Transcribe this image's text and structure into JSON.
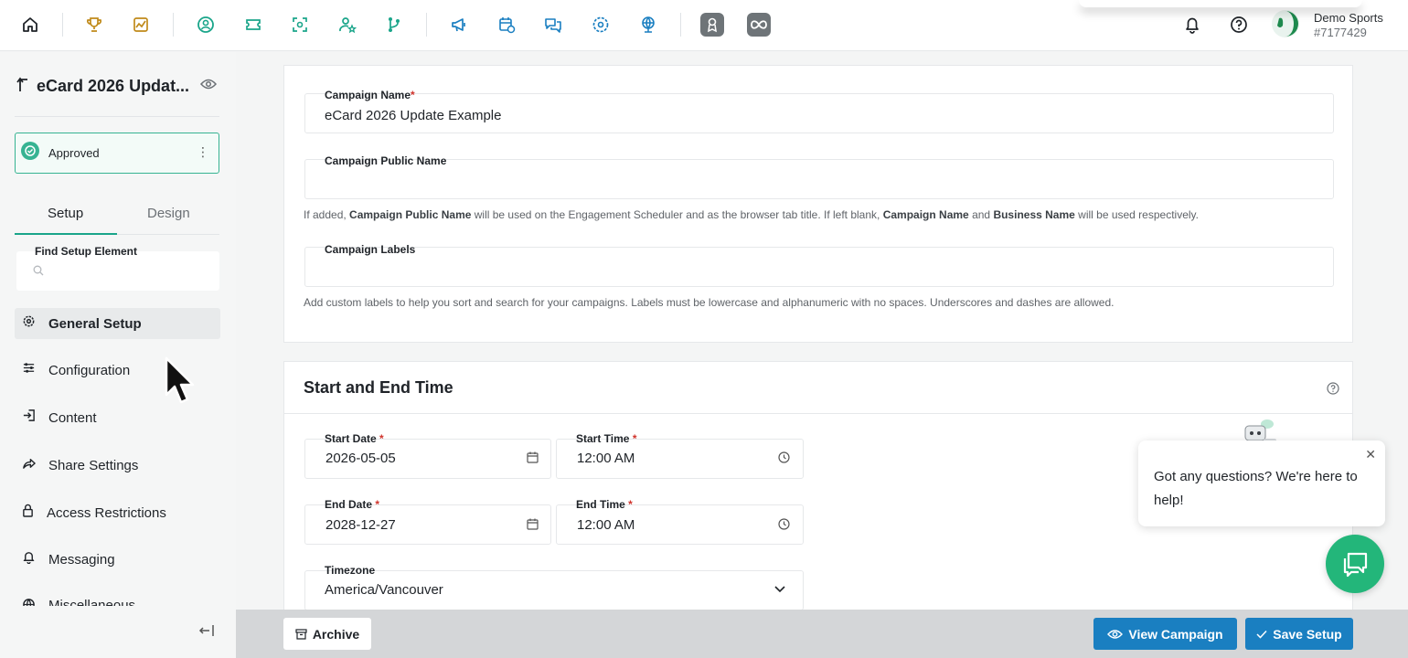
{
  "colors": {
    "accent": "#1aa58a",
    "primary_button": "#1a7fc1",
    "chat_green": "#23b67a",
    "required": "#d0342c"
  },
  "topbar": {
    "icons": [
      "home-icon",
      "trophy-icon",
      "analytics-icon",
      "user-circle-icon",
      "ticket-icon",
      "scan-icon",
      "user-star-icon",
      "branch-icon",
      "megaphone-icon",
      "calendar-clock-icon",
      "chat-icon",
      "gear-badge-icon",
      "globe-icon",
      "app-r-icon",
      "app-infinity-icon"
    ],
    "user": {
      "name": "Demo Sports",
      "id": "#7177429"
    }
  },
  "sidebar": {
    "title": "eCard 2026 Updat...",
    "status": "Approved",
    "tabs": [
      {
        "label": "Setup",
        "active": true
      },
      {
        "label": "Design",
        "active": false
      }
    ],
    "find_label": "Find Setup Element",
    "items": [
      {
        "label": "General Setup",
        "icon": "gear-icon",
        "active": true
      },
      {
        "label": "Configuration",
        "icon": "sliders-icon",
        "active": false
      },
      {
        "label": "Content",
        "icon": "enter-icon",
        "active": false
      },
      {
        "label": "Share Settings",
        "icon": "share-icon",
        "active": false
      },
      {
        "label": "Access Restrictions",
        "icon": "lock-icon",
        "active": false
      },
      {
        "label": "Messaging",
        "icon": "bell-icon",
        "active": false
      },
      {
        "label": "Miscellaneous",
        "icon": "globe-icon",
        "active": false
      }
    ]
  },
  "general": {
    "campaign_name_label": "Campaign Name",
    "campaign_name_value": "eCard 2026 Update Example",
    "public_name_label": "Campaign Public Name",
    "public_name_hint": {
      "p1": "If added, ",
      "b1": "Campaign Public Name",
      "p2": " will be used on the Engagement Scheduler and as the browser tab title. If left blank, ",
      "b2": "Campaign Name",
      "p3": " and ",
      "b3": "Business Name",
      "p4": " will be used respectively."
    },
    "labels_label": "Campaign Labels",
    "labels_hint": "Add custom labels to help you sort and search for your campaigns. Labels must be lowercase and alphanumeric with no spaces. Underscores and dashes are allowed."
  },
  "schedule": {
    "title": "Start and End Time",
    "start_date_label": "Start Date",
    "start_date": "2026-05-05",
    "start_time_label": "Start Time",
    "start_time": "12:00 AM",
    "end_date_label": "End Date",
    "end_date": "2028-12-27",
    "end_time_label": "End Time",
    "end_time": "12:00 AM",
    "timezone_label": "Timezone",
    "timezone": "America/Vancouver"
  },
  "actions": {
    "archive": "Archive",
    "view": "View Campaign",
    "save": "Save Setup"
  },
  "chat": {
    "message": "Got any questions? We're here to help!"
  }
}
